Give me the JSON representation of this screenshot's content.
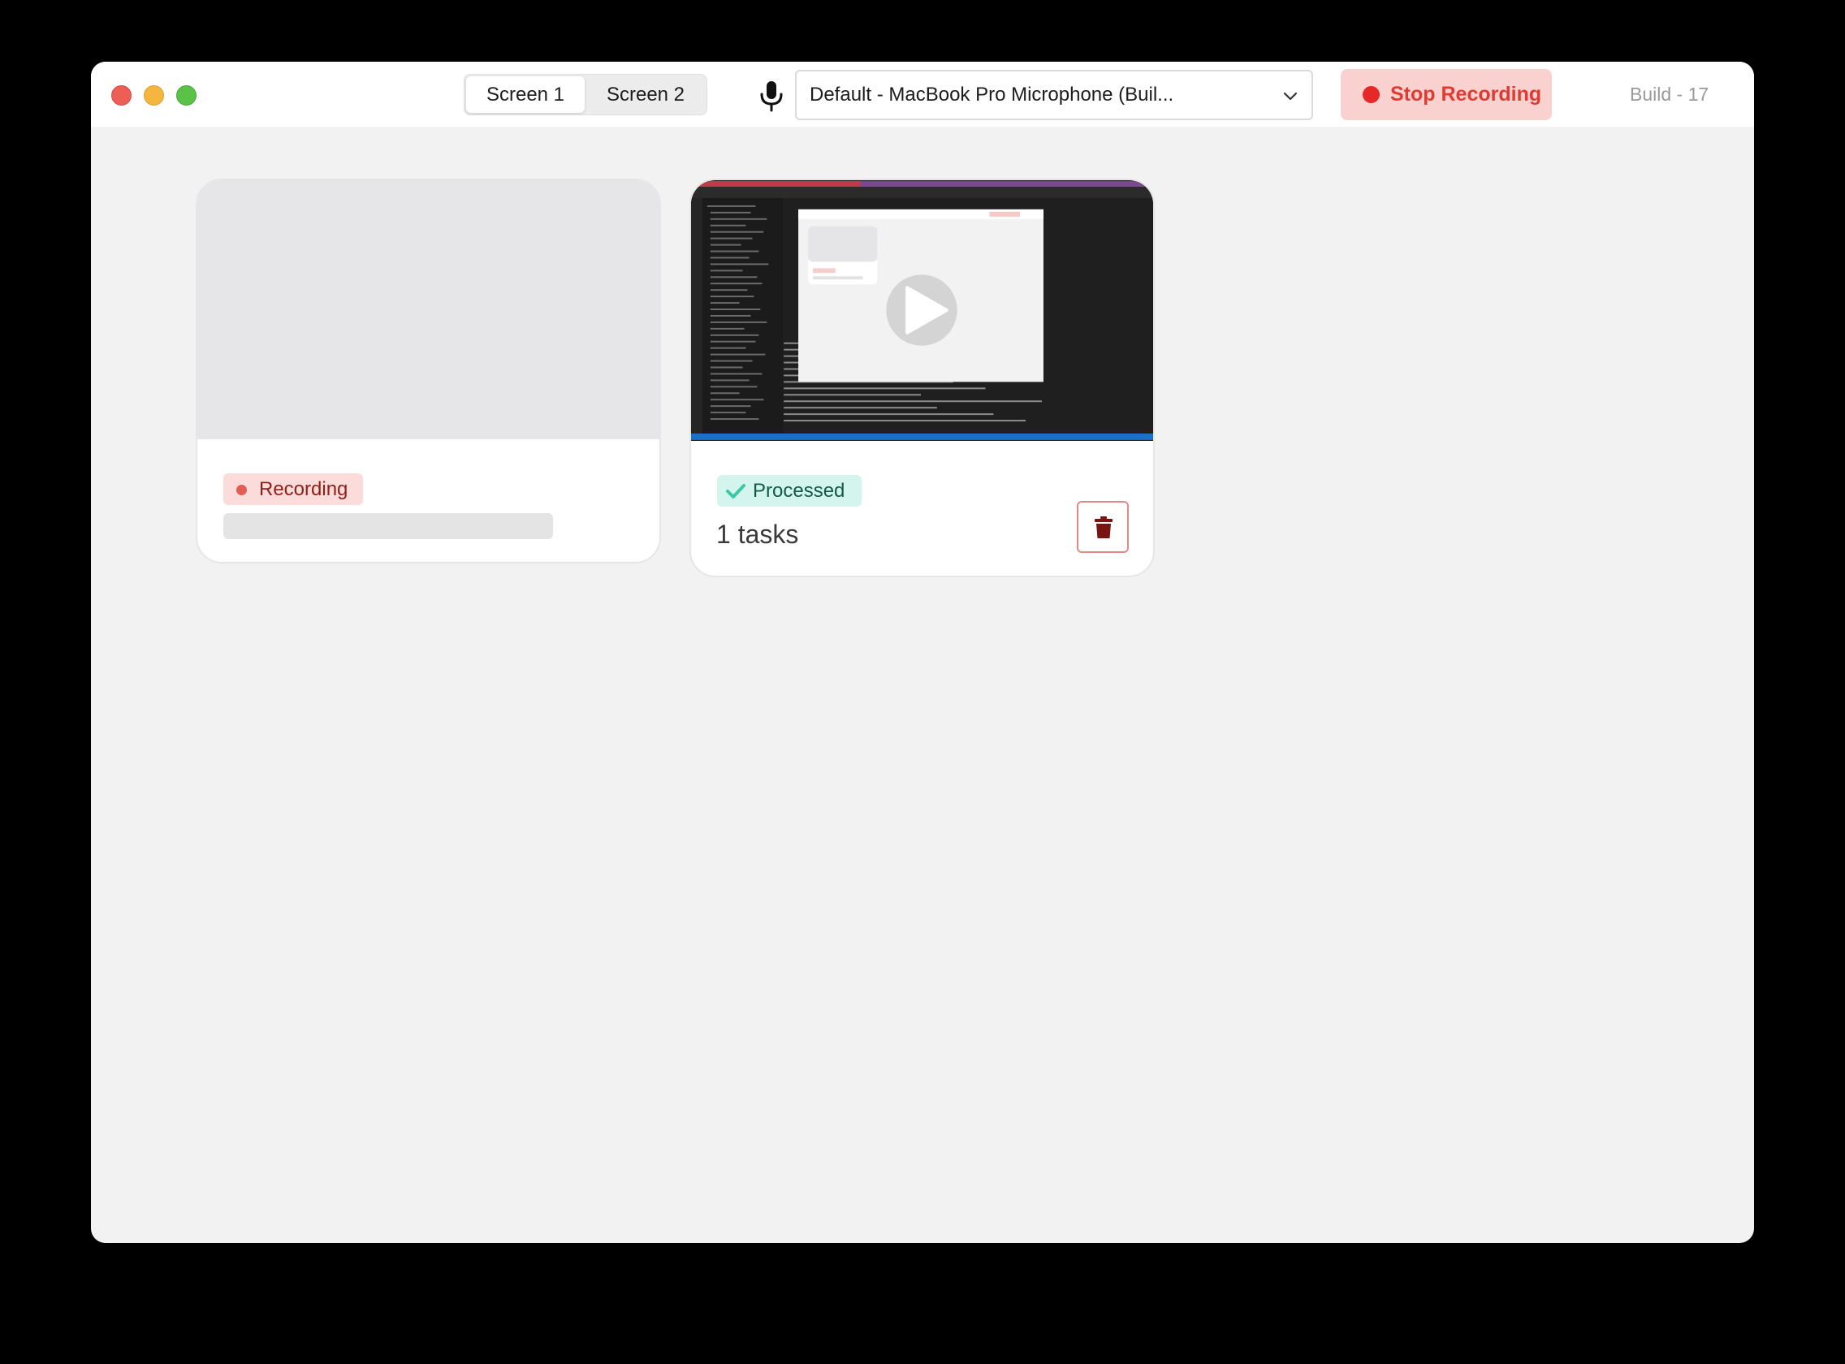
{
  "titlebar": {
    "screens": [
      "Screen 1",
      "Screen 2"
    ],
    "selected_screen": "Screen 1",
    "microphone_select_value": "Default - MacBook Pro Microphone (Buil...",
    "stop_label": "Stop Recording",
    "build_label": "Build - 17"
  },
  "cards": [
    {
      "status": "Recording"
    },
    {
      "status": "Processed",
      "tasks_label": "1 tasks"
    }
  ],
  "colors": {
    "recording_red": "#e62828",
    "processed_green": "#3ec8a6"
  },
  "icons": [
    "microphone-icon",
    "chevron-down-icon",
    "record-dot-icon",
    "checkmark-icon",
    "play-icon",
    "trash-icon"
  ]
}
